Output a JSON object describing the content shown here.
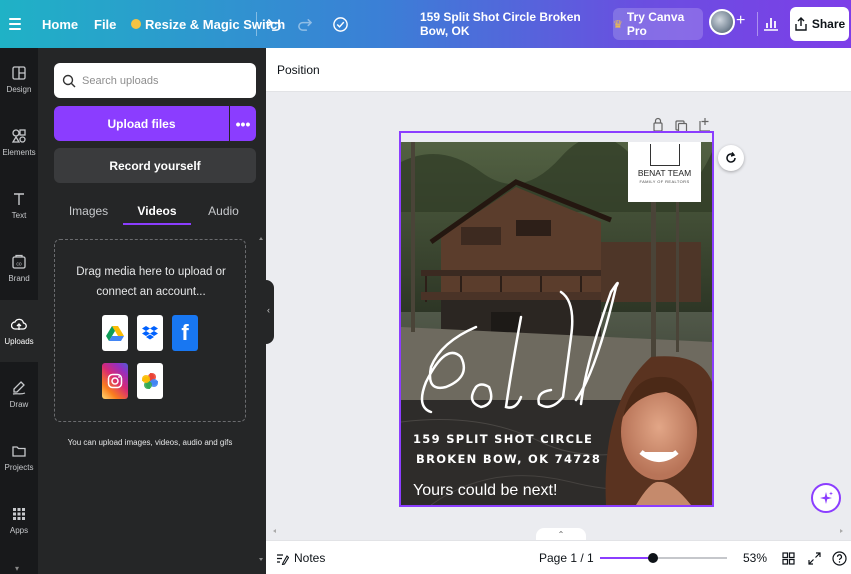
{
  "topbar": {
    "home_label": "Home",
    "file_label": "File",
    "magic_label": "Resize & Magic Switch",
    "undo_icon": "undo-icon",
    "redo_icon": "redo-icon",
    "cloud_icon": "cloud-saved-icon",
    "design_title": "159 Split Shot Circle Broken Bow, OK",
    "pro_label": "Try Canva Pro",
    "share_label": "Share"
  },
  "rail": {
    "items": [
      {
        "label": "Design",
        "icon": "design-icon"
      },
      {
        "label": "Elements",
        "icon": "elements-icon"
      },
      {
        "label": "Text",
        "icon": "text-icon"
      },
      {
        "label": "Brand",
        "icon": "brand-icon"
      },
      {
        "label": "Uploads",
        "icon": "uploads-icon"
      },
      {
        "label": "Draw",
        "icon": "draw-icon"
      },
      {
        "label": "Projects",
        "icon": "projects-icon"
      },
      {
        "label": "Apps",
        "icon": "apps-icon"
      }
    ],
    "active": "Uploads"
  },
  "panel": {
    "search_placeholder": "Search uploads",
    "upload_label": "Upload files",
    "more_label": "•••",
    "record_label": "Record yourself",
    "tabs": [
      "Images",
      "Videos",
      "Audio"
    ],
    "active_tab": "Videos",
    "dropzone_line1": "Drag media here to upload or",
    "dropzone_line2": "connect an account...",
    "services": [
      "google-drive-icon",
      "dropbox-icon",
      "facebook-icon",
      "instagram-icon",
      "google-photos-icon"
    ],
    "note": "You can upload images, videos, audio and gifs"
  },
  "context": {
    "position_label": "Position"
  },
  "design": {
    "logo_name": "BENAT TEAM",
    "logo_sub": "FAMILY OF REALTORS",
    "script_text": "Sold",
    "address_line1": "159 SPLIT SHOT CIRCLE",
    "address_line2": "BROKEN BOW, OK 74728",
    "tagline": "Yours could be next!"
  },
  "bottombar": {
    "notes_label": "Notes",
    "page_label": "Page 1 / 1",
    "zoom_fraction": 0.42,
    "zoom_label": "53%"
  },
  "colors": {
    "accent": "#8b3dff",
    "panel_bg": "#252627",
    "rail_bg": "#18191b"
  }
}
